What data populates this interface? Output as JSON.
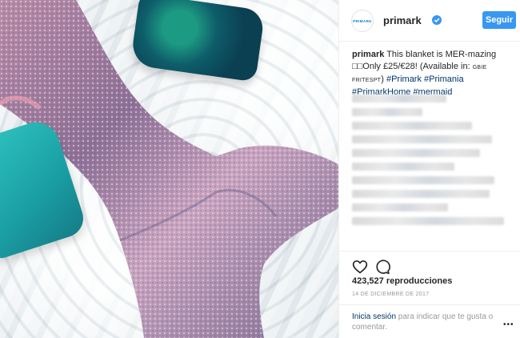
{
  "post": {
    "username": "primark",
    "avatar_text": "PRIMARK",
    "follow_label": "Seguir",
    "caption": {
      "username": "primark",
      "text_1": " This blanket is MER-mazing ",
      "emoji": "□□",
      "text_2": "Only £25/€28! (Available in: ",
      "small_codes": "GBIE FRITESPT",
      "text_3": ") ",
      "hashtags": [
        "#Primark",
        "#Primania",
        "#PrimarkHome",
        "#mermaid"
      ]
    },
    "views": "423,527 reproducciones",
    "date": "14 DE DICIEMBRE DE 2017",
    "login_prompt": {
      "link": "Inicia sesión",
      "text": " para indicar que te gusta o comentar."
    },
    "more_label": "•••"
  },
  "colors": {
    "follow_bg": "#3897f0",
    "link": "#003569",
    "verified": "#3897f0"
  },
  "icons": {
    "verified": "verified-badge-icon",
    "like": "heart-icon",
    "comment": "comment-bubble-icon",
    "more": "more-options-icon"
  }
}
